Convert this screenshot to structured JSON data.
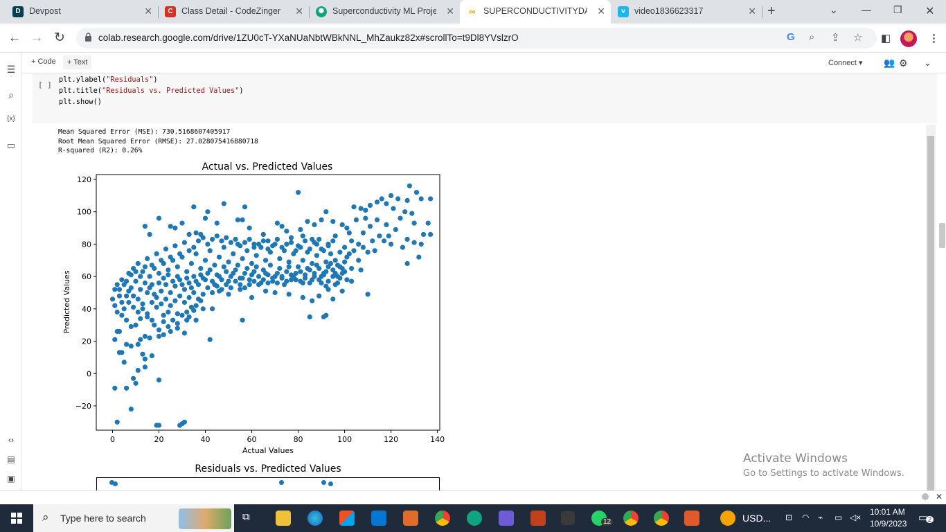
{
  "browser": {
    "tabs": [
      {
        "title": "Devpost",
        "icon": "devpost-icon",
        "color": "#003e54"
      },
      {
        "title": "Class Detail - CodeZinger",
        "icon": "codezinger-icon",
        "color": "#d93025"
      },
      {
        "title": "Superconductivity ML Proje",
        "icon": "chatgpt-icon",
        "color": "#10a37f"
      },
      {
        "title": "SUPERCONDUCTIVITYDATA",
        "icon": "colab-icon",
        "color": "#f9ab00"
      },
      {
        "title": "video1836623317",
        "icon": "vimeo-icon",
        "color": "#1ab7ea"
      }
    ],
    "url": "colab.research.google.com/drive/1ZU0cT-YXaNUaNbtWBkNNL_MhZaukz82x#scrollTo=t9Dl8YVslzrO"
  },
  "colab": {
    "add_code": "+ Code",
    "add_text": "+ Text",
    "connect": "Connect",
    "cell_gutter": "[ ]",
    "code_lines": [
      "plt.ylabel(\"Residuals\")",
      "plt.title(\"Residuals vs. Predicted Values\")",
      "plt.show()"
    ],
    "output_lines": [
      "Mean Squared Error (MSE): 730.5168607405917",
      "Root Mean Squared Error (RMSE): 27.028075416880718",
      "R-squared (R2): 0.26%"
    ],
    "second_plot_title": "Residuals vs. Predicted Values"
  },
  "chart_data": {
    "type": "scatter",
    "title": "Actual vs. Predicted Values",
    "xlabel": "Actual Values",
    "ylabel": "Predicted Values",
    "xlim": [
      -7,
      141
    ],
    "ylim": [
      -35,
      123
    ],
    "xticks": [
      0,
      20,
      40,
      60,
      80,
      100,
      120,
      140
    ],
    "yticks": [
      -20,
      0,
      20,
      40,
      60,
      80,
      100,
      120
    ],
    "color": "#1f77b4",
    "points": [
      [
        1,
        -9
      ],
      [
        2,
        -30
      ],
      [
        6,
        -9
      ],
      [
        8,
        -22
      ],
      [
        9,
        -3
      ],
      [
        10,
        -6
      ],
      [
        11,
        2
      ],
      [
        14,
        4
      ],
      [
        20,
        -4
      ],
      [
        19,
        -32
      ],
      [
        20,
        -32
      ],
      [
        29,
        -32
      ],
      [
        30,
        -31
      ],
      [
        31,
        -30
      ],
      [
        5,
        7
      ],
      [
        3,
        13
      ],
      [
        4,
        13
      ],
      [
        6,
        18
      ],
      [
        8,
        17
      ],
      [
        2,
        26
      ],
      [
        1,
        21
      ],
      [
        3,
        26
      ],
      [
        11,
        18
      ],
      [
        13,
        12
      ],
      [
        14,
        9
      ],
      [
        17,
        11
      ],
      [
        12,
        21
      ],
      [
        14,
        23
      ],
      [
        16,
        22
      ],
      [
        20,
        23
      ],
      [
        22,
        24
      ],
      [
        25,
        26
      ],
      [
        28,
        28
      ],
      [
        31,
        25
      ],
      [
        33,
        35
      ],
      [
        36,
        33
      ],
      [
        42,
        21
      ],
      [
        56,
        33
      ],
      [
        85,
        35
      ],
      [
        91,
        35
      ],
      [
        92,
        36
      ],
      [
        110,
        49
      ],
      [
        103,
        57
      ],
      [
        96,
        55
      ],
      [
        99,
        51
      ],
      [
        95,
        46
      ],
      [
        92,
        54
      ],
      [
        90,
        60
      ],
      [
        127,
        68
      ],
      [
        132,
        72
      ],
      [
        128,
        116
      ],
      [
        131,
        112
      ],
      [
        137,
        108
      ],
      [
        133,
        108
      ],
      [
        127,
        107
      ],
      [
        123,
        108
      ],
      [
        120,
        110
      ],
      [
        80,
        112
      ],
      [
        57,
        103
      ],
      [
        48,
        105
      ],
      [
        41,
        100
      ],
      [
        35,
        103
      ],
      [
        40,
        96
      ],
      [
        45,
        93
      ],
      [
        54,
        95
      ],
      [
        56,
        95
      ],
      [
        59,
        90
      ],
      [
        71,
        93
      ],
      [
        73,
        91
      ],
      [
        75,
        88
      ],
      [
        81,
        89
      ],
      [
        84,
        94
      ],
      [
        87,
        92
      ],
      [
        90,
        95
      ],
      [
        92,
        100
      ],
      [
        95,
        94
      ],
      [
        99,
        92
      ],
      [
        101,
        90
      ],
      [
        104,
        103
      ],
      [
        107,
        102
      ],
      [
        109,
        101
      ],
      [
        111,
        104
      ],
      [
        114,
        106
      ],
      [
        116,
        108
      ],
      [
        118,
        105
      ],
      [
        121,
        102
      ],
      [
        124,
        96
      ],
      [
        126,
        100
      ],
      [
        129,
        99
      ],
      [
        130,
        93
      ],
      [
        134,
        86
      ],
      [
        136,
        93
      ],
      [
        137,
        86
      ],
      [
        133,
        80
      ],
      [
        130,
        81
      ],
      [
        25,
        91
      ],
      [
        27,
        90
      ],
      [
        14,
        91
      ],
      [
        16,
        86
      ],
      [
        20,
        96
      ],
      [
        30,
        93
      ],
      [
        36,
        87
      ],
      [
        38,
        86
      ],
      [
        33,
        86
      ],
      [
        61,
        80
      ],
      [
        65,
        86
      ],
      [
        67,
        82
      ],
      [
        77,
        81
      ],
      [
        82,
        85
      ],
      [
        86,
        83
      ],
      [
        88,
        80
      ],
      [
        93,
        79
      ],
      [
        96,
        85
      ],
      [
        102,
        87
      ],
      [
        108,
        87
      ],
      [
        112,
        82
      ],
      [
        115,
        85
      ],
      [
        120,
        80
      ],
      [
        125,
        78
      ],
      [
        127,
        83
      ],
      [
        110,
        75
      ],
      [
        106,
        70
      ],
      [
        103,
        65
      ],
      [
        107,
        64
      ],
      [
        100,
        63
      ],
      [
        97,
        60
      ],
      [
        93,
        52
      ],
      [
        89,
        48
      ],
      [
        86,
        45
      ],
      [
        82,
        47
      ],
      [
        76,
        49
      ],
      [
        70,
        50
      ],
      [
        66,
        51
      ],
      [
        60,
        47
      ],
      [
        55,
        52
      ],
      [
        50,
        49
      ],
      [
        46,
        51
      ],
      [
        43,
        40
      ],
      [
        39,
        40
      ],
      [
        35,
        39
      ],
      [
        32,
        38
      ],
      [
        28,
        37
      ],
      [
        24,
        38
      ],
      [
        22,
        36
      ],
      [
        17,
        33
      ],
      [
        15,
        35
      ],
      [
        12,
        34
      ],
      [
        10,
        30
      ],
      [
        8,
        29
      ],
      [
        6,
        33
      ],
      [
        4,
        36
      ],
      [
        2,
        38
      ],
      [
        1,
        42
      ],
      [
        0,
        46
      ],
      [
        1,
        52
      ],
      [
        3,
        52
      ],
      [
        5,
        55
      ],
      [
        7,
        51
      ],
      [
        9,
        48
      ],
      [
        11,
        46
      ],
      [
        13,
        43
      ],
      [
        15,
        50
      ],
      [
        17,
        44
      ],
      [
        19,
        47
      ],
      [
        21,
        51
      ],
      [
        23,
        55
      ],
      [
        25,
        50
      ],
      [
        27,
        54
      ],
      [
        29,
        58
      ],
      [
        31,
        52
      ],
      [
        33,
        56
      ],
      [
        35,
        60
      ],
      [
        37,
        55
      ],
      [
        39,
        59
      ],
      [
        41,
        62
      ],
      [
        43,
        57
      ],
      [
        45,
        61
      ],
      [
        47,
        58
      ],
      [
        49,
        63
      ],
      [
        51,
        60
      ],
      [
        53,
        64
      ],
      [
        55,
        59
      ],
      [
        57,
        62
      ],
      [
        59,
        58
      ],
      [
        61,
        63
      ],
      [
        63,
        60
      ],
      [
        65,
        64
      ],
      [
        67,
        61
      ],
      [
        69,
        57
      ],
      [
        71,
        62
      ],
      [
        73,
        59
      ],
      [
        75,
        63
      ],
      [
        77,
        58
      ],
      [
        79,
        62
      ],
      [
        81,
        57
      ],
      [
        83,
        61
      ],
      [
        85,
        56
      ],
      [
        87,
        62
      ],
      [
        89,
        58
      ],
      [
        91,
        61
      ],
      [
        93,
        57
      ],
      [
        95,
        60
      ],
      [
        97,
        56
      ],
      [
        99,
        62
      ],
      [
        101,
        58
      ],
      [
        16,
        60
      ],
      [
        18,
        65
      ],
      [
        20,
        62
      ],
      [
        22,
        68
      ],
      [
        24,
        64
      ],
      [
        26,
        70
      ],
      [
        28,
        66
      ],
      [
        30,
        72
      ],
      [
        32,
        63
      ],
      [
        34,
        68
      ],
      [
        36,
        74
      ],
      [
        38,
        65
      ],
      [
        40,
        70
      ],
      [
        42,
        76
      ],
      [
        44,
        67
      ],
      [
        46,
        72
      ],
      [
        48,
        78
      ],
      [
        50,
        69
      ],
      [
        52,
        74
      ],
      [
        54,
        80
      ],
      [
        56,
        71
      ],
      [
        58,
        76
      ],
      [
        60,
        68
      ],
      [
        62,
        73
      ],
      [
        64,
        78
      ],
      [
        66,
        70
      ],
      [
        68,
        75
      ],
      [
        70,
        80
      ],
      [
        72,
        71
      ],
      [
        74,
        76
      ],
      [
        76,
        69
      ],
      [
        78,
        74
      ],
      [
        80,
        79
      ],
      [
        82,
        70
      ],
      [
        84,
        75
      ],
      [
        86,
        68
      ],
      [
        88,
        73
      ],
      [
        90,
        77
      ],
      [
        92,
        69
      ],
      [
        94,
        74
      ],
      [
        96,
        70
      ],
      [
        98,
        66
      ],
      [
        14,
        56
      ],
      [
        12,
        52
      ],
      [
        10,
        57
      ],
      [
        8,
        53
      ],
      [
        6,
        48
      ],
      [
        4,
        44
      ],
      [
        9,
        41
      ],
      [
        11,
        38
      ],
      [
        13,
        40
      ],
      [
        15,
        37
      ],
      [
        17,
        55
      ],
      [
        19,
        41
      ],
      [
        21,
        43
      ],
      [
        23,
        46
      ],
      [
        25,
        42
      ],
      [
        27,
        45
      ],
      [
        29,
        48
      ],
      [
        31,
        44
      ],
      [
        33,
        47
      ],
      [
        35,
        50
      ],
      [
        37,
        46
      ],
      [
        39,
        49
      ],
      [
        41,
        53
      ],
      [
        43,
        50
      ],
      [
        45,
        54
      ],
      [
        47,
        52
      ],
      [
        49,
        55
      ],
      [
        51,
        53
      ],
      [
        53,
        57
      ],
      [
        55,
        55
      ],
      [
        57,
        53
      ],
      [
        59,
        55
      ],
      [
        61,
        57
      ],
      [
        63,
        55
      ],
      [
        65,
        58
      ],
      [
        67,
        56
      ],
      [
        69,
        59
      ],
      [
        71,
        56
      ],
      [
        73,
        60
      ],
      [
        75,
        57
      ],
      [
        77,
        61
      ],
      [
        79,
        58
      ],
      [
        81,
        63
      ],
      [
        83,
        59
      ],
      [
        85,
        64
      ],
      [
        87,
        60
      ],
      [
        89,
        65
      ],
      [
        91,
        62
      ],
      [
        93,
        66
      ],
      [
        95,
        64
      ],
      [
        97,
        67
      ],
      [
        99,
        65
      ],
      [
        7,
        62
      ],
      [
        9,
        65
      ],
      [
        11,
        68
      ],
      [
        13,
        63
      ],
      [
        15,
        71
      ],
      [
        17,
        67
      ],
      [
        19,
        74
      ],
      [
        21,
        70
      ],
      [
        23,
        77
      ],
      [
        25,
        72
      ],
      [
        27,
        79
      ],
      [
        29,
        74
      ],
      [
        31,
        81
      ],
      [
        33,
        76
      ],
      [
        35,
        78
      ],
      [
        37,
        82
      ],
      [
        39,
        84
      ],
      [
        41,
        80
      ],
      [
        43,
        83
      ],
      [
        45,
        85
      ],
      [
        47,
        82
      ],
      [
        49,
        84
      ],
      [
        51,
        81
      ],
      [
        53,
        83
      ],
      [
        55,
        79
      ],
      [
        57,
        81
      ],
      [
        59,
        83
      ],
      [
        61,
        78
      ],
      [
        63,
        80
      ],
      [
        65,
        82
      ],
      [
        67,
        77
      ],
      [
        69,
        79
      ],
      [
        71,
        83
      ],
      [
        73,
        78
      ],
      [
        75,
        80
      ],
      [
        77,
        84
      ],
      [
        79,
        76
      ],
      [
        81,
        78
      ],
      [
        83,
        82
      ],
      [
        85,
        77
      ],
      [
        87,
        81
      ],
      [
        89,
        83
      ],
      [
        91,
        76
      ],
      [
        93,
        80
      ],
      [
        95,
        82
      ],
      [
        100,
        78
      ],
      [
        102,
        74
      ],
      [
        104,
        76
      ],
      [
        106,
        80
      ],
      [
        108,
        78
      ],
      [
        113,
        76
      ],
      [
        117,
        82
      ],
      [
        119,
        85
      ],
      [
        122,
        89
      ],
      [
        118,
        92
      ],
      [
        114,
        95
      ],
      [
        111,
        91
      ],
      [
        109,
        96
      ],
      [
        105,
        95
      ],
      [
        103,
        82
      ],
      [
        101,
        72
      ],
      [
        98,
        75
      ],
      [
        40,
        58
      ],
      [
        42,
        64
      ],
      [
        44,
        55
      ],
      [
        46,
        60
      ],
      [
        48,
        66
      ],
      [
        50,
        57
      ],
      [
        52,
        62
      ],
      [
        54,
        67
      ],
      [
        56,
        59
      ],
      [
        58,
        65
      ],
      [
        60,
        61
      ],
      [
        62,
        66
      ],
      [
        64,
        56
      ],
      [
        66,
        62
      ],
      [
        68,
        67
      ],
      [
        70,
        60
      ],
      [
        72,
        65
      ],
      [
        74,
        55
      ],
      [
        76,
        66
      ],
      [
        78,
        60
      ],
      [
        80,
        66
      ],
      [
        82,
        56
      ],
      [
        84,
        65
      ],
      [
        86,
        58
      ],
      [
        88,
        67
      ],
      [
        90,
        56
      ],
      [
        92,
        63
      ],
      [
        94,
        68
      ],
      [
        96,
        62
      ],
      [
        98,
        59
      ],
      [
        100,
        69
      ],
      [
        18,
        30
      ],
      [
        20,
        27
      ],
      [
        22,
        32
      ],
      [
        24,
        29
      ],
      [
        26,
        33
      ],
      [
        28,
        31
      ],
      [
        30,
        36
      ],
      [
        32,
        33
      ],
      [
        34,
        41
      ],
      [
        36,
        42
      ],
      [
        38,
        45
      ],
      [
        5,
        40
      ],
      [
        7,
        44
      ],
      [
        3,
        48
      ],
      [
        2,
        55
      ],
      [
        4,
        58
      ],
      [
        6,
        57
      ],
      [
        8,
        61
      ],
      [
        10,
        63
      ],
      [
        12,
        60
      ],
      [
        14,
        66
      ],
      [
        16,
        53
      ],
      [
        18,
        49
      ],
      [
        20,
        56
      ],
      [
        22,
        59
      ],
      [
        24,
        61
      ],
      [
        26,
        57
      ],
      [
        28,
        60
      ],
      [
        30,
        55
      ],
      [
        32,
        59
      ],
      [
        34,
        53
      ],
      [
        36,
        57
      ],
      [
        38,
        61
      ]
    ]
  },
  "taskbar": {
    "search_placeholder": "Type here to search",
    "tray_text": "USD...",
    "time": "10:01 AM",
    "date": "10/9/2023",
    "whatsapp_badge": "12",
    "notification_count": "2"
  },
  "watermark": {
    "line1": "Activate Windows",
    "line2": "Go to Settings to activate Windows."
  }
}
